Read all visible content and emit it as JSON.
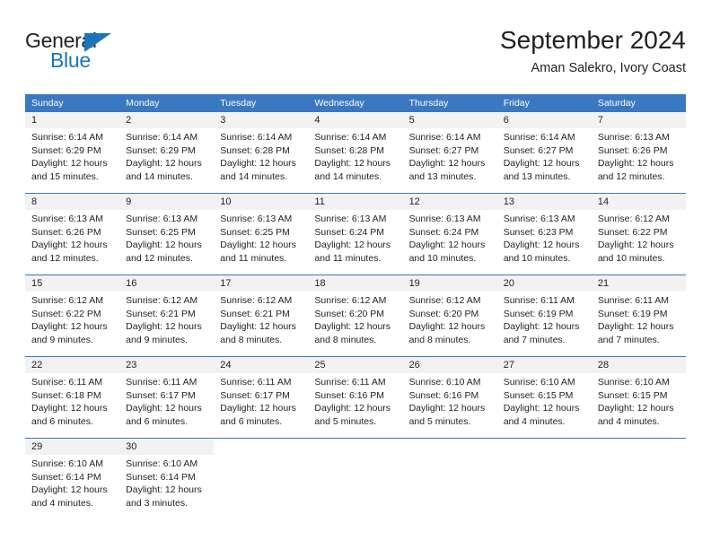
{
  "logo": {
    "word1": "General",
    "word2": "Blue",
    "triangle_color": "#1b75bc"
  },
  "header": {
    "title": "September 2024",
    "subtitle": "Aman Salekro, Ivory Coast"
  },
  "colors": {
    "header_blue": "#3a78c2",
    "daynum_band": "#f2f2f2",
    "text": "#231f20"
  },
  "calendar": {
    "weekday_headers": [
      "Sunday",
      "Monday",
      "Tuesday",
      "Wednesday",
      "Thursday",
      "Friday",
      "Saturday"
    ],
    "weeks": [
      [
        {
          "day": "1",
          "sunrise": "Sunrise: 6:14 AM",
          "sunset": "Sunset: 6:29 PM",
          "daylight1": "Daylight: 12 hours",
          "daylight2": "and 15 minutes."
        },
        {
          "day": "2",
          "sunrise": "Sunrise: 6:14 AM",
          "sunset": "Sunset: 6:29 PM",
          "daylight1": "Daylight: 12 hours",
          "daylight2": "and 14 minutes."
        },
        {
          "day": "3",
          "sunrise": "Sunrise: 6:14 AM",
          "sunset": "Sunset: 6:28 PM",
          "daylight1": "Daylight: 12 hours",
          "daylight2": "and 14 minutes."
        },
        {
          "day": "4",
          "sunrise": "Sunrise: 6:14 AM",
          "sunset": "Sunset: 6:28 PM",
          "daylight1": "Daylight: 12 hours",
          "daylight2": "and 14 minutes."
        },
        {
          "day": "5",
          "sunrise": "Sunrise: 6:14 AM",
          "sunset": "Sunset: 6:27 PM",
          "daylight1": "Daylight: 12 hours",
          "daylight2": "and 13 minutes."
        },
        {
          "day": "6",
          "sunrise": "Sunrise: 6:14 AM",
          "sunset": "Sunset: 6:27 PM",
          "daylight1": "Daylight: 12 hours",
          "daylight2": "and 13 minutes."
        },
        {
          "day": "7",
          "sunrise": "Sunrise: 6:13 AM",
          "sunset": "Sunset: 6:26 PM",
          "daylight1": "Daylight: 12 hours",
          "daylight2": "and 12 minutes."
        }
      ],
      [
        {
          "day": "8",
          "sunrise": "Sunrise: 6:13 AM",
          "sunset": "Sunset: 6:26 PM",
          "daylight1": "Daylight: 12 hours",
          "daylight2": "and 12 minutes."
        },
        {
          "day": "9",
          "sunrise": "Sunrise: 6:13 AM",
          "sunset": "Sunset: 6:25 PM",
          "daylight1": "Daylight: 12 hours",
          "daylight2": "and 12 minutes."
        },
        {
          "day": "10",
          "sunrise": "Sunrise: 6:13 AM",
          "sunset": "Sunset: 6:25 PM",
          "daylight1": "Daylight: 12 hours",
          "daylight2": "and 11 minutes."
        },
        {
          "day": "11",
          "sunrise": "Sunrise: 6:13 AM",
          "sunset": "Sunset: 6:24 PM",
          "daylight1": "Daylight: 12 hours",
          "daylight2": "and 11 minutes."
        },
        {
          "day": "12",
          "sunrise": "Sunrise: 6:13 AM",
          "sunset": "Sunset: 6:24 PM",
          "daylight1": "Daylight: 12 hours",
          "daylight2": "and 10 minutes."
        },
        {
          "day": "13",
          "sunrise": "Sunrise: 6:13 AM",
          "sunset": "Sunset: 6:23 PM",
          "daylight1": "Daylight: 12 hours",
          "daylight2": "and 10 minutes."
        },
        {
          "day": "14",
          "sunrise": "Sunrise: 6:12 AM",
          "sunset": "Sunset: 6:22 PM",
          "daylight1": "Daylight: 12 hours",
          "daylight2": "and 10 minutes."
        }
      ],
      [
        {
          "day": "15",
          "sunrise": "Sunrise: 6:12 AM",
          "sunset": "Sunset: 6:22 PM",
          "daylight1": "Daylight: 12 hours",
          "daylight2": "and 9 minutes."
        },
        {
          "day": "16",
          "sunrise": "Sunrise: 6:12 AM",
          "sunset": "Sunset: 6:21 PM",
          "daylight1": "Daylight: 12 hours",
          "daylight2": "and 9 minutes."
        },
        {
          "day": "17",
          "sunrise": "Sunrise: 6:12 AM",
          "sunset": "Sunset: 6:21 PM",
          "daylight1": "Daylight: 12 hours",
          "daylight2": "and 8 minutes."
        },
        {
          "day": "18",
          "sunrise": "Sunrise: 6:12 AM",
          "sunset": "Sunset: 6:20 PM",
          "daylight1": "Daylight: 12 hours",
          "daylight2": "and 8 minutes."
        },
        {
          "day": "19",
          "sunrise": "Sunrise: 6:12 AM",
          "sunset": "Sunset: 6:20 PM",
          "daylight1": "Daylight: 12 hours",
          "daylight2": "and 8 minutes."
        },
        {
          "day": "20",
          "sunrise": "Sunrise: 6:11 AM",
          "sunset": "Sunset: 6:19 PM",
          "daylight1": "Daylight: 12 hours",
          "daylight2": "and 7 minutes."
        },
        {
          "day": "21",
          "sunrise": "Sunrise: 6:11 AM",
          "sunset": "Sunset: 6:19 PM",
          "daylight1": "Daylight: 12 hours",
          "daylight2": "and 7 minutes."
        }
      ],
      [
        {
          "day": "22",
          "sunrise": "Sunrise: 6:11 AM",
          "sunset": "Sunset: 6:18 PM",
          "daylight1": "Daylight: 12 hours",
          "daylight2": "and 6 minutes."
        },
        {
          "day": "23",
          "sunrise": "Sunrise: 6:11 AM",
          "sunset": "Sunset: 6:17 PM",
          "daylight1": "Daylight: 12 hours",
          "daylight2": "and 6 minutes."
        },
        {
          "day": "24",
          "sunrise": "Sunrise: 6:11 AM",
          "sunset": "Sunset: 6:17 PM",
          "daylight1": "Daylight: 12 hours",
          "daylight2": "and 6 minutes."
        },
        {
          "day": "25",
          "sunrise": "Sunrise: 6:11 AM",
          "sunset": "Sunset: 6:16 PM",
          "daylight1": "Daylight: 12 hours",
          "daylight2": "and 5 minutes."
        },
        {
          "day": "26",
          "sunrise": "Sunrise: 6:10 AM",
          "sunset": "Sunset: 6:16 PM",
          "daylight1": "Daylight: 12 hours",
          "daylight2": "and 5 minutes."
        },
        {
          "day": "27",
          "sunrise": "Sunrise: 6:10 AM",
          "sunset": "Sunset: 6:15 PM",
          "daylight1": "Daylight: 12 hours",
          "daylight2": "and 4 minutes."
        },
        {
          "day": "28",
          "sunrise": "Sunrise: 6:10 AM",
          "sunset": "Sunset: 6:15 PM",
          "daylight1": "Daylight: 12 hours",
          "daylight2": "and 4 minutes."
        }
      ],
      [
        {
          "day": "29",
          "sunrise": "Sunrise: 6:10 AM",
          "sunset": "Sunset: 6:14 PM",
          "daylight1": "Daylight: 12 hours",
          "daylight2": "and 4 minutes."
        },
        {
          "day": "30",
          "sunrise": "Sunrise: 6:10 AM",
          "sunset": "Sunset: 6:14 PM",
          "daylight1": "Daylight: 12 hours",
          "daylight2": "and 3 minutes."
        },
        null,
        null,
        null,
        null,
        null
      ]
    ]
  }
}
